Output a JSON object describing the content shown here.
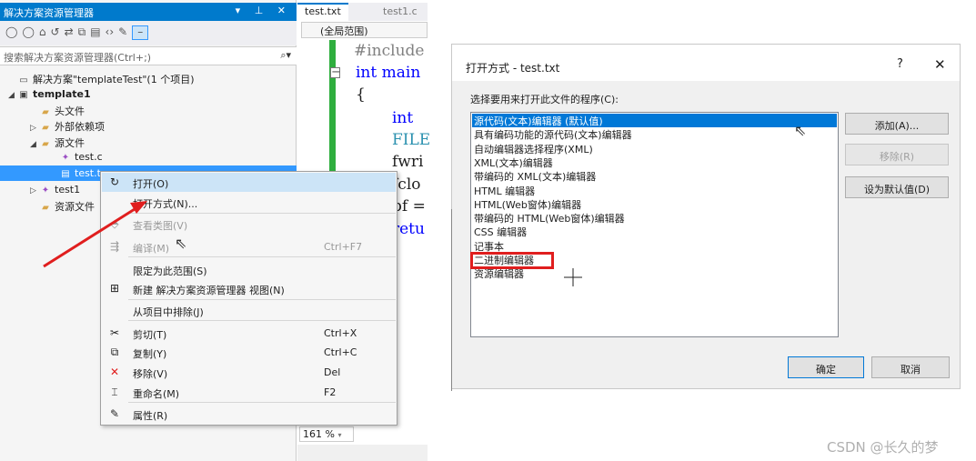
{
  "solution_explorer": {
    "title": "解决方案资源管理器",
    "title_controls": "▾ ⊥ ✕",
    "search_placeholder": "搜索解决方案资源管理器(Ctrl+;)",
    "tree": [
      {
        "label": "解决方案\"templateTest\"(1 个项目)",
        "icon": "solution-icon",
        "expander": ""
      },
      {
        "label": "template1",
        "icon": "project-icon",
        "expander": "◢"
      },
      {
        "label": "头文件",
        "icon": "folder-icon",
        "expander": ""
      },
      {
        "label": "外部依赖项",
        "icon": "folder-icon",
        "expander": "▷"
      },
      {
        "label": "源文件",
        "icon": "folder-icon",
        "expander": "◢"
      },
      {
        "label": "test.c",
        "icon": "cpp-file-icon",
        "expander": ""
      },
      {
        "label": "test.t",
        "icon": "text-file-icon",
        "expander": ""
      },
      {
        "label": "test1",
        "icon": "cpp-file-icon",
        "expander": "▷"
      },
      {
        "label": "资源文件",
        "icon": "folder-icon",
        "expander": ""
      }
    ]
  },
  "editor": {
    "tabs": [
      "test.txt",
      "test1.c"
    ],
    "scope": "(全局范围)",
    "zoom": "161 %",
    "code_lines": [
      "#include",
      "int main",
      "{",
      "int",
      "FILE",
      "fwri",
      "fclo",
      "pf =",
      "retu"
    ]
  },
  "context_menu": {
    "items": [
      {
        "label": "打开(O)",
        "shortcut": "",
        "icon": "open-icon",
        "disabled": false
      },
      {
        "label": "打开方式(N)...",
        "shortcut": "",
        "icon": "",
        "disabled": false
      },
      {
        "label": "查看类图(V)",
        "shortcut": "",
        "icon": "class-diagram-icon",
        "disabled": true
      },
      {
        "label": "编译(M)",
        "shortcut": "Ctrl+F7",
        "icon": "compile-icon",
        "disabled": true
      },
      {
        "label": "限定为此范围(S)",
        "shortcut": "",
        "icon": "",
        "disabled": false
      },
      {
        "label": "新建 解决方案资源管理器 视图(N)",
        "shortcut": "",
        "icon": "new-view-icon",
        "disabled": false
      },
      {
        "label": "从项目中排除(J)",
        "shortcut": "",
        "icon": "",
        "disabled": false
      },
      {
        "label": "剪切(T)",
        "shortcut": "Ctrl+X",
        "icon": "scissors-icon",
        "disabled": false
      },
      {
        "label": "复制(Y)",
        "shortcut": "Ctrl+C",
        "icon": "copy-icon",
        "disabled": false
      },
      {
        "label": "移除(V)",
        "shortcut": "Del",
        "icon": "remove-x-icon",
        "disabled": false
      },
      {
        "label": "重命名(M)",
        "shortcut": "F2",
        "icon": "rename-icon",
        "disabled": false
      },
      {
        "label": "属性(R)",
        "shortcut": "",
        "icon": "wrench-icon",
        "disabled": false
      }
    ]
  },
  "dialog": {
    "title": "打开方式 - test.txt",
    "help": "?",
    "close": "✕",
    "prompt": "选择要用来打开此文件的程序(C):",
    "programs": [
      "源代码(文本)编辑器 (默认值)",
      "具有编码功能的源代码(文本)编辑器",
      "自动编辑器选择程序(XML)",
      "XML(文本)编辑器",
      "带编码的 XML(文本)编辑器",
      "HTML 编辑器",
      "HTML(Web窗体)编辑器",
      "带编码的 HTML(Web窗体)编辑器",
      "CSS 编辑器",
      "记事本",
      "二进制编辑器",
      "资源编辑器"
    ],
    "selected_index": 0,
    "highlighted_index": 10,
    "buttons": {
      "add": "添加(A)...",
      "remove": "移除(R)",
      "set_default": "设为默认值(D)",
      "ok": "确定",
      "cancel": "取消"
    }
  },
  "watermark": "CSDN @长久的梦",
  "colors": {
    "accent": "#007acc",
    "selection": "#3399ff",
    "list_selection": "#0078d7",
    "highlight_box": "#e01e1e"
  }
}
